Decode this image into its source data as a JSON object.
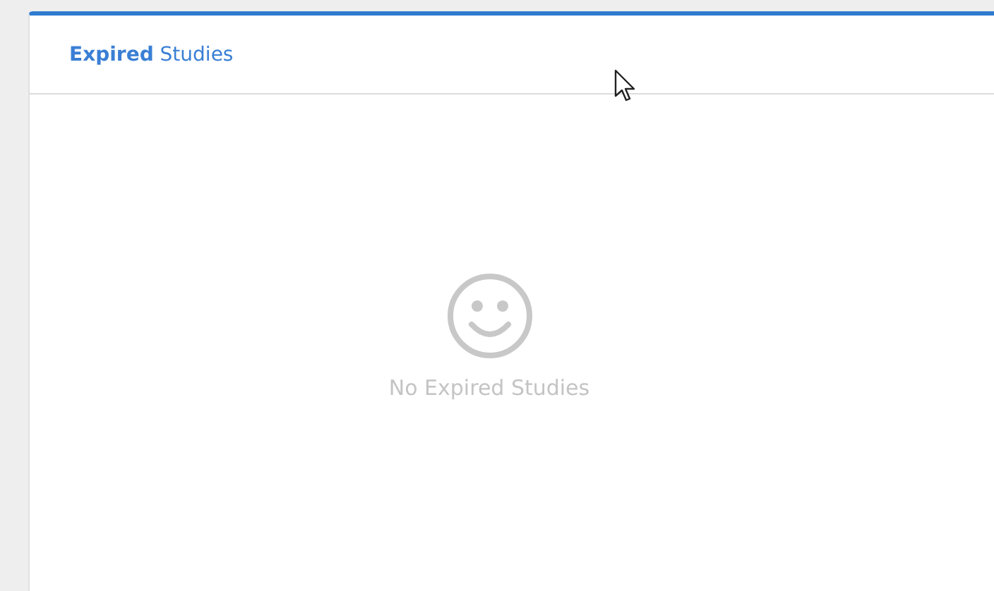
{
  "panel": {
    "title": "**Expired** Studies",
    "empty_message": "No Expired Studies"
  }
}
